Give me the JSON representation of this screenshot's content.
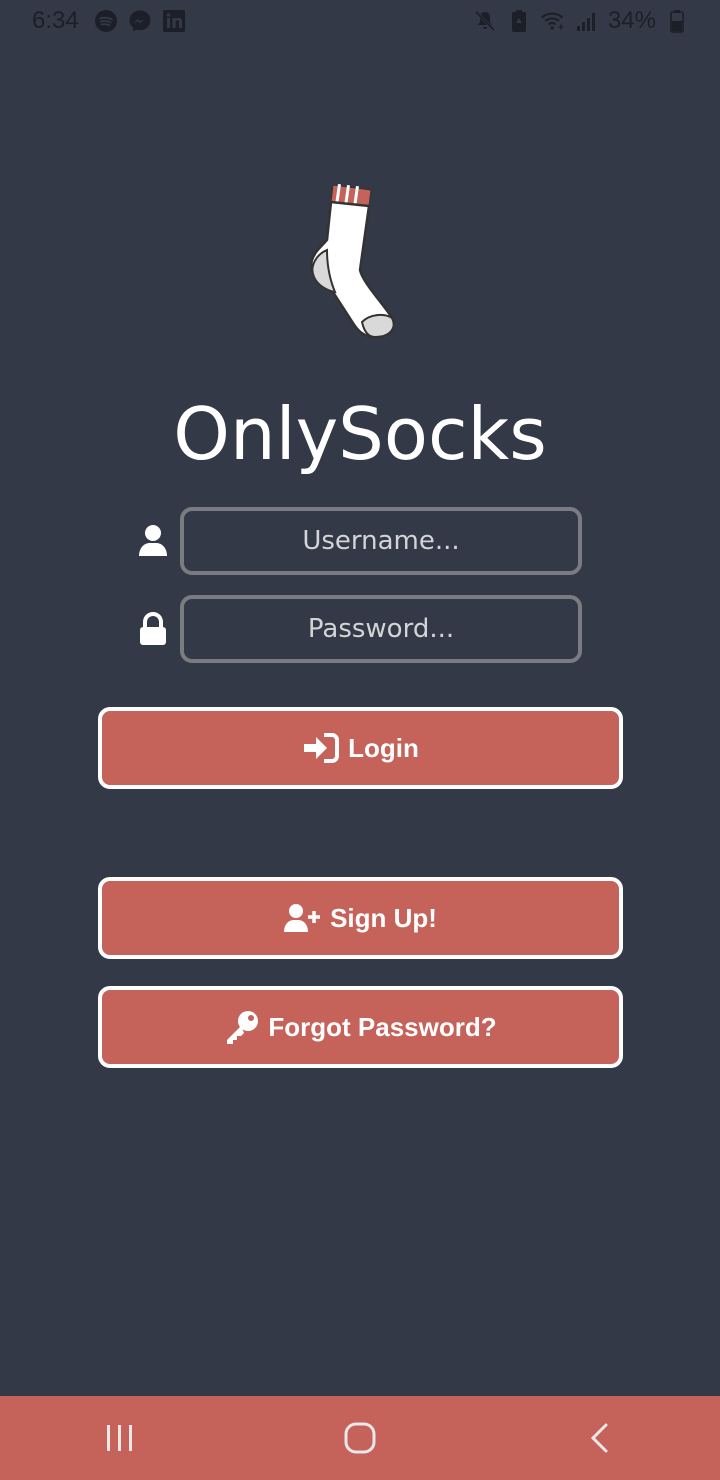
{
  "status_bar": {
    "time": "6:34",
    "battery": "34%",
    "left_icons": [
      "spotify-icon",
      "messenger-icon",
      "linkedin-icon"
    ],
    "right_icons": [
      "mute-icon",
      "battery-saver-icon",
      "wifi-icon",
      "signal-icon",
      "battery-icon"
    ]
  },
  "app": {
    "title": "OnlySocks",
    "logo": "sock-logo"
  },
  "form": {
    "username_placeholder": "Username...",
    "password_placeholder": "Password..."
  },
  "buttons": {
    "login": "Login",
    "signup": "Sign Up!",
    "forgot": "Forgot Password?"
  },
  "nav": {
    "items": [
      "recent-apps-icon",
      "home-icon",
      "back-icon"
    ]
  },
  "colors": {
    "background": "#343947",
    "accent": "#c5625a",
    "border": "#ffffff"
  }
}
